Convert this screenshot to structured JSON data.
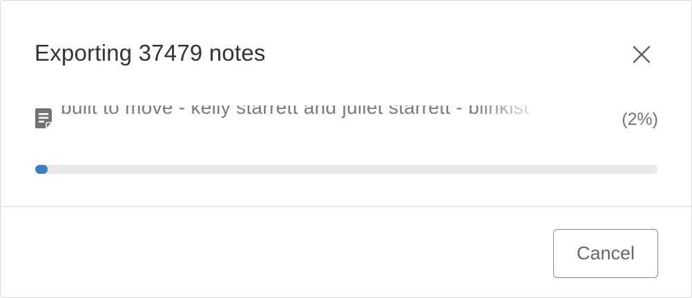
{
  "dialog": {
    "title": "Exporting 37479 notes",
    "close_icon": "close-icon"
  },
  "status": {
    "note_icon": "note-document-icon",
    "current_note": "built to move - kelly starrett and juliet starrett - blinkist",
    "percent_text": "(2%)"
  },
  "progress": {
    "fraction": 0.02,
    "fill_color": "#3a7ebf",
    "track_color": "#e8e8e8"
  },
  "footer": {
    "cancel_label": "Cancel"
  }
}
